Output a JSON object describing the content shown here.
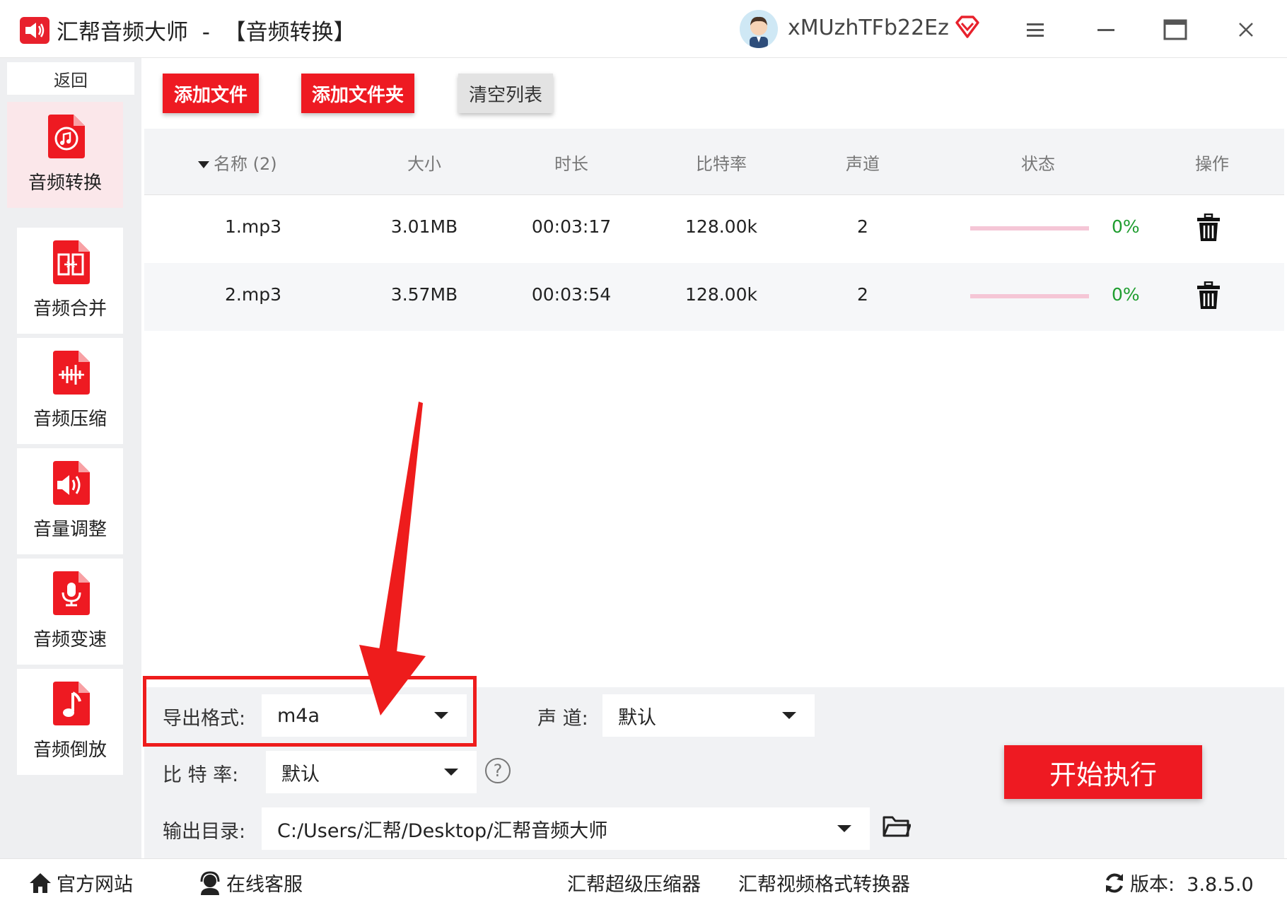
{
  "window": {
    "app_name": "汇帮音频大师",
    "title_suffix": "  -  【音频转换】",
    "username": "xMUzhTFb22Ez",
    "icons": [
      "menu-icon",
      "minimize-icon",
      "maximize-icon",
      "close-icon"
    ]
  },
  "sidebar": {
    "back_label": "返回",
    "items": [
      {
        "label": "音频转换",
        "icon": "audio-convert-icon",
        "active": true
      },
      {
        "label": "音频合并",
        "icon": "audio-merge-icon",
        "active": false
      },
      {
        "label": "音频压缩",
        "icon": "audio-compress-icon",
        "active": false
      },
      {
        "label": "音量调整",
        "icon": "volume-adjust-icon",
        "active": false
      },
      {
        "label": "音频变速",
        "icon": "audio-speed-icon",
        "active": false
      },
      {
        "label": "音频倒放",
        "icon": "audio-reverse-icon",
        "active": false
      }
    ]
  },
  "toolbar": {
    "add_file": "添加文件",
    "add_folder": "添加文件夹",
    "clear_list": "清空列表"
  },
  "table": {
    "headers": {
      "name": "名称 (2)",
      "size": "大小",
      "duration": "时长",
      "bitrate": "比特率",
      "channels": "声道",
      "status": "状态",
      "action": "操作"
    },
    "rows": [
      {
        "name": "1.mp3",
        "size": "3.01MB",
        "duration": "00:03:17",
        "bitrate": "128.00k",
        "channels": "2",
        "progress": 0,
        "percent": "0%"
      },
      {
        "name": "2.mp3",
        "size": "3.57MB",
        "duration": "00:03:54",
        "bitrate": "128.00k",
        "channels": "2",
        "progress": 0,
        "percent": "0%"
      }
    ]
  },
  "settings": {
    "format_label": "导出格式:",
    "format_value": "m4a",
    "channel_label": "声 道:",
    "channel_value": "默认",
    "bitrate_label": "比 特 率:",
    "bitrate_value": "默认",
    "help_glyph": "?",
    "output_label": "输出目录:",
    "output_value": "C:/Users/汇帮/Desktop/汇帮音频大师",
    "start_label": "开始执行"
  },
  "footer": {
    "website": "官方网站",
    "support": "在线客服",
    "compressor": "汇帮超级压缩器",
    "video_converter": "汇帮视频格式转换器",
    "version": "版本:  3.8.5.0"
  },
  "colors": {
    "accent_red": "#ee1a22",
    "progress_track": "#f5c6d6",
    "percent_green": "#1f9d2f",
    "sidebar_bg": "#eeeff1"
  }
}
